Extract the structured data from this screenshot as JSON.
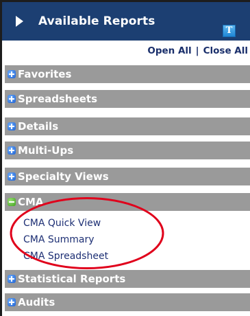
{
  "header": {
    "title": "Available Reports",
    "help_label": "T"
  },
  "controls": {
    "open_all": "Open All",
    "separator": "|",
    "close_all": "Close All"
  },
  "sections": [
    {
      "title": "Favorites",
      "state": "collapsed"
    },
    {
      "title": "Spreadsheets",
      "state": "collapsed"
    },
    {
      "title": "Details",
      "state": "collapsed"
    },
    {
      "title": "Multi-Ups",
      "state": "collapsed"
    },
    {
      "title": "Specialty Views",
      "state": "collapsed"
    },
    {
      "title": "CMA",
      "state": "expanded",
      "items": [
        "CMA Quick View",
        "CMA Summary",
        "CMA Spreadsheet"
      ]
    },
    {
      "title": "Statistical Reports",
      "state": "collapsed"
    },
    {
      "title": "Audits",
      "state": "collapsed"
    }
  ],
  "colors": {
    "header_bg": "#1c3f72",
    "section_bg": "#9a9a9a",
    "link_text": "#1d2f74",
    "highlight": "#e0001b"
  }
}
